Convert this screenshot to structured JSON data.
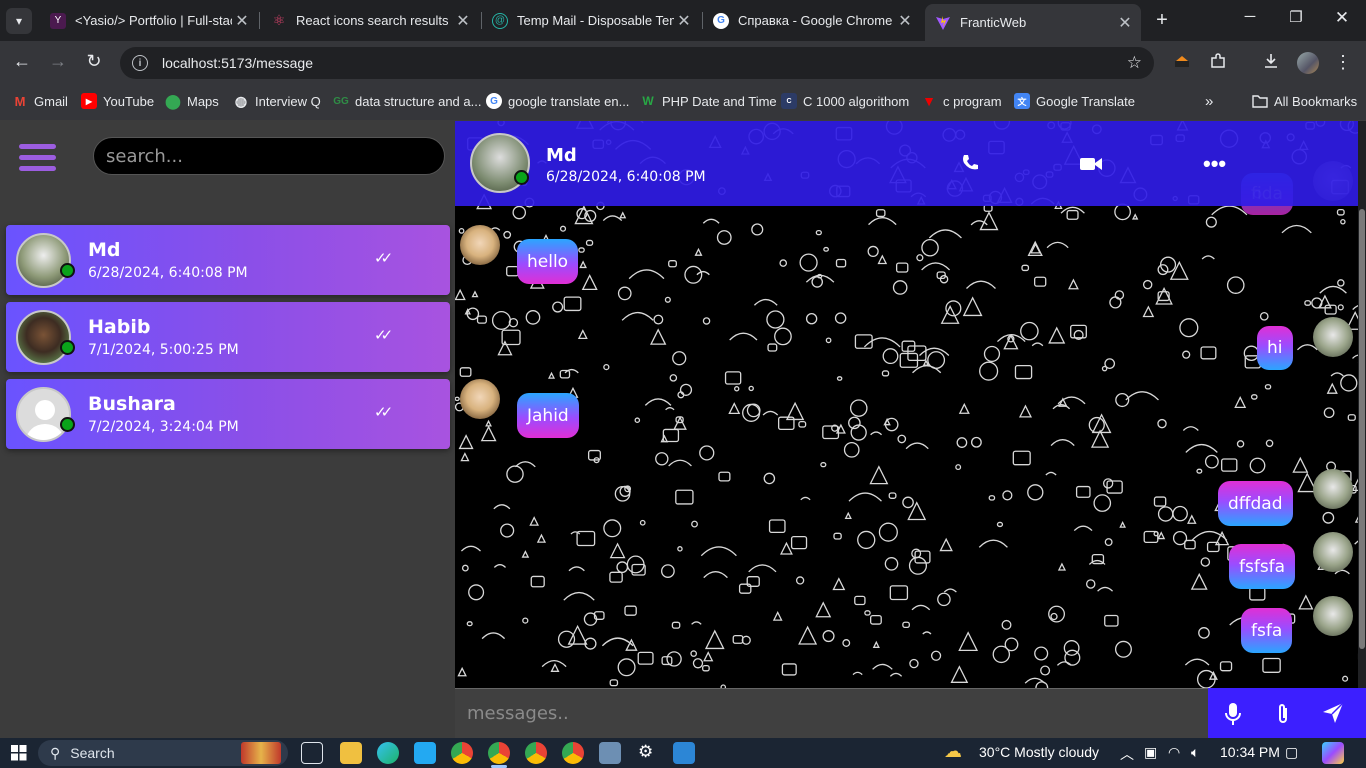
{
  "browser": {
    "tabs": [
      {
        "title": "<Yasio/> Portfolio | Full-stac",
        "icon": "yasio-favicon"
      },
      {
        "title": "React icons search results",
        "icon": "react-favicon"
      },
      {
        "title": "Temp Mail - Disposable Tem",
        "icon": "tempmail-favicon"
      },
      {
        "title": "Справка - Google Chrome",
        "icon": "google-favicon"
      },
      {
        "title": "FranticWeb",
        "icon": "vite-favicon",
        "active": true
      }
    ],
    "url": "localhost:5173/message",
    "bookmarks": [
      {
        "label": "Gmail"
      },
      {
        "label": "YouTube"
      },
      {
        "label": "Maps"
      },
      {
        "label": "Interview Q"
      },
      {
        "label": "data structure and a..."
      },
      {
        "label": "google translate en..."
      },
      {
        "label": "PHP Date and Time"
      },
      {
        "label": "C 1000  algorithom"
      },
      {
        "label": "c program"
      },
      {
        "label": "Google Translate"
      }
    ],
    "all_bookmarks_label": "All Bookmarks"
  },
  "sidebar": {
    "search_placeholder": "search...",
    "contacts": [
      {
        "name": "Md",
        "time": "6/28/2024, 6:40:08 PM"
      },
      {
        "name": "Habib",
        "time": "7/1/2024, 5:00:25 PM"
      },
      {
        "name": "Bushara",
        "time": "7/2/2024, 3:24:04 PM"
      }
    ]
  },
  "chat": {
    "header": {
      "name": "Md",
      "time": "6/28/2024, 6:40:08 PM"
    },
    "peek_message": "fida",
    "messages": [
      {
        "text": "hello",
        "side": "in"
      },
      {
        "text": "hi",
        "side": "out"
      },
      {
        "text": "Jahid",
        "side": "in"
      },
      {
        "text": "dffdad",
        "side": "out"
      },
      {
        "text": "fsfsfa",
        "side": "out"
      },
      {
        "text": "fsfa",
        "side": "out"
      }
    ],
    "input_placeholder": "messages.."
  },
  "taskbar": {
    "search_label": "Search",
    "weather": "30°C  Mostly cloudy",
    "time": "10:34 PM"
  },
  "colors": {
    "accent_purple": "#8b4fe8",
    "header_blue": "#301ce6",
    "online_green": "#0aa31a",
    "action_bar": "#3c1fff"
  }
}
